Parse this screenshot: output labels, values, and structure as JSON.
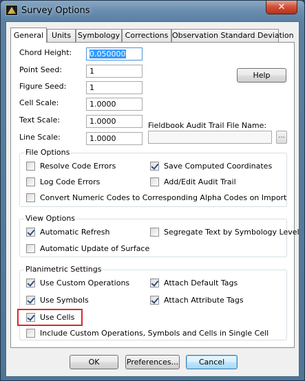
{
  "window": {
    "title": "Survey Options",
    "close": "✕"
  },
  "tabs": [
    {
      "label": "General",
      "active": true
    },
    {
      "label": "Units",
      "active": false
    },
    {
      "label": "Symbology",
      "active": false
    },
    {
      "label": "Corrections",
      "active": false
    },
    {
      "label": "Observation Standard Deviation",
      "active": false
    }
  ],
  "general": {
    "chord_height": {
      "label": "Chord Height:",
      "value": "0.050000"
    },
    "point_seed": {
      "label": "Point Seed:",
      "value": "1"
    },
    "figure_seed": {
      "label": "Figure Seed:",
      "value": "1"
    },
    "cell_scale": {
      "label": "Cell Scale:",
      "value": "1.0000"
    },
    "text_scale": {
      "label": "Text Scale:",
      "value": "1.0000"
    },
    "line_scale": {
      "label": "Line Scale:",
      "value": "1.0000"
    },
    "help_label": "Help",
    "fieldbook": {
      "label": "Fieldbook Audit Trail File Name:",
      "value": "",
      "browse_label": "..."
    }
  },
  "file_options": {
    "title": "File Options",
    "resolve_code_errors": {
      "label": "Resolve Code Errors",
      "checked": false
    },
    "save_computed_coordinates": {
      "label": "Save Computed Coordinates",
      "checked": true
    },
    "log_code_errors": {
      "label": "Log Code Errors",
      "checked": false
    },
    "add_edit_audit_trail": {
      "label": "Add/Edit Audit Trail",
      "checked": false
    },
    "convert_numeric_codes": {
      "label": "Convert Numeric Codes to Corresponding Alpha Codes on Import",
      "checked": false
    }
  },
  "view_options": {
    "title": "View Options",
    "automatic_refresh": {
      "label": "Automatic Refresh",
      "checked": true
    },
    "segregate_text": {
      "label": "Segregate Text by Symbology Level",
      "checked": false
    },
    "automatic_update_surface": {
      "label": "Automatic Update of Surface",
      "checked": false
    }
  },
  "planimetric": {
    "title": "Planimetric Settings",
    "use_custom_operations": {
      "label": "Use Custom Operations",
      "checked": true
    },
    "attach_default_tags": {
      "label": "Attach Default Tags",
      "checked": true
    },
    "use_symbols": {
      "label": "Use Symbols",
      "checked": true
    },
    "attach_attribute_tags": {
      "label": "Attach Attribute Tags",
      "checked": true
    },
    "use_cells": {
      "label": "Use Cells",
      "checked": true
    },
    "include_single_cell": {
      "label": "Include Custom Operations, Symbols and Cells in Single Cell",
      "checked": false
    }
  },
  "footer": {
    "ok": "OK",
    "preferences": "Preferences...",
    "cancel": "Cancel"
  },
  "colors": {
    "highlight": "#d42a2a",
    "titlebar": "#6c8fb0",
    "close": "#c8412b"
  }
}
